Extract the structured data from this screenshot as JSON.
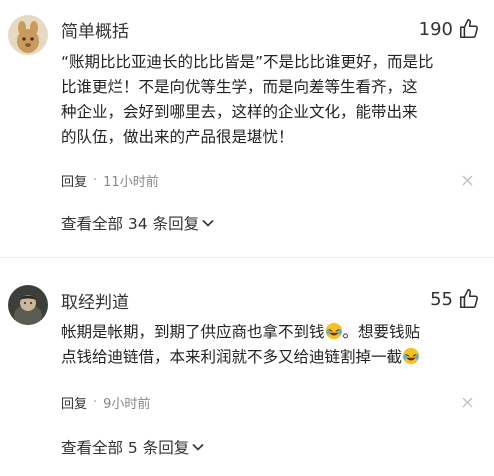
{
  "comments": [
    {
      "username": "简单概括",
      "likes": "190",
      "body_lines": [
        "“账期比比亚迪长的比比皆是”不是比比谁更好，而是比",
        "比谁更烂！不是向优等生学，而是向差等生看齐，这",
        "种企业，会好到哪里去，这样的企业文化，能带出来",
        "的队伍，做出来的产品很是堪忧！"
      ],
      "reply_label": "回复",
      "time": "11小时前",
      "view_replies": "查看全部 34 条回复"
    },
    {
      "username": "取经判道",
      "likes": "55",
      "body_line1_a": "帐期是帐期，到期了供应商也拿不到钱",
      "body_line1_b": "。想要钱贴",
      "body_line2": "点钱给迪链借，本来利润就不多又给迪链割掉一截",
      "reply_label": "回复",
      "time": "9小时前",
      "view_replies": "查看全部 5 条回复"
    }
  ],
  "icons": {
    "like": "thumbs-up-icon",
    "close": "close-icon",
    "chevron": "chevron-down-icon",
    "emoji": "laughing-crying-emoji"
  },
  "colors": {
    "text": "#222222",
    "muted": "#888888",
    "emoji": "#f5b800"
  }
}
